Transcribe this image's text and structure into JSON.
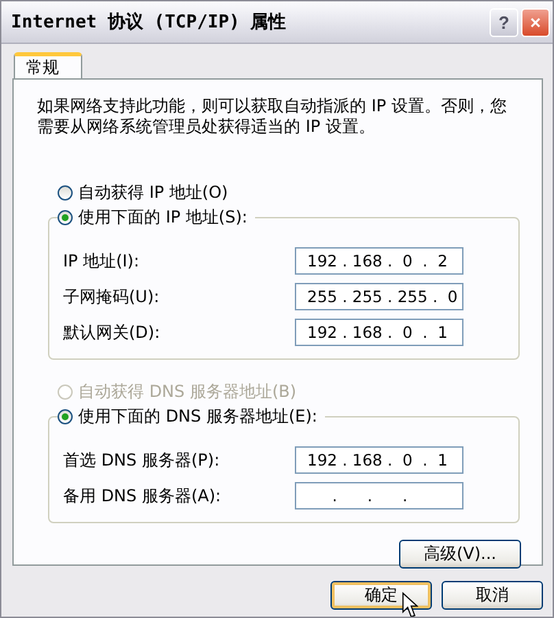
{
  "window": {
    "title": "Internet 协议 (TCP/IP) 属性",
    "title_buttons": [
      {
        "kind": "help",
        "label": "?"
      },
      {
        "kind": "close"
      }
    ]
  },
  "tabs": [
    {
      "label": "常规",
      "selected": true
    }
  ],
  "description": "如果网络支持此功能，则可以获取自动指派的 IP 设置。否则，您需要从网络系统管理员处获得适当的 IP 设置。",
  "ip_section": {
    "auto_radio": {
      "label": "自动获得 IP 地址(O)",
      "selected": false,
      "disabled": false
    },
    "manual_radio": {
      "label": "使用下面的 IP 地址(S):",
      "selected": true,
      "disabled": false
    },
    "fields": [
      {
        "label": "IP 地址(I):",
        "value": "192 . 168 .  0  .  2"
      },
      {
        "label": "子网掩码(U):",
        "value": "255 . 255 . 255 .  0"
      },
      {
        "label": "默认网关(D):",
        "value": "192 . 168 .  0  .  1"
      }
    ]
  },
  "dns_section": {
    "auto_radio": {
      "label": "自动获得 DNS 服务器地址(B)",
      "selected": false,
      "disabled": true
    },
    "manual_radio": {
      "label": "使用下面的 DNS 服务器地址(E):",
      "selected": true,
      "disabled": false
    },
    "fields": [
      {
        "label": "首选 DNS 服务器(P):",
        "value": "192 . 168 .  0  .  1"
      },
      {
        "label": "备用 DNS 服务器(A):",
        "value": "     .      .      ."
      }
    ]
  },
  "advanced_button": "高级(V)...",
  "buttons": [
    {
      "label": "确定",
      "focused": true
    },
    {
      "label": "取消",
      "focused": false
    }
  ]
}
